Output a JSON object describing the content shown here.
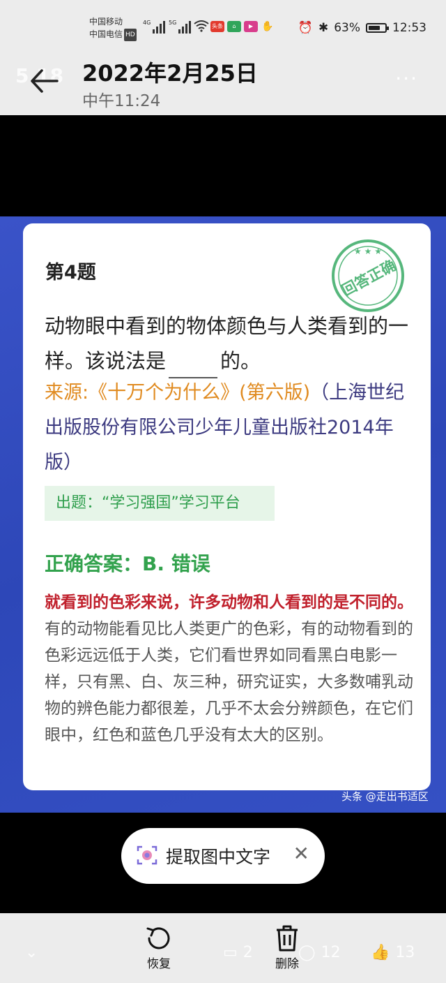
{
  "status": {
    "carrier1": "中国移动",
    "carrier2": "中国电信",
    "hd": "HD",
    "net1": "4G",
    "net2": "5G",
    "battery": "63%",
    "clock": "12:53"
  },
  "header": {
    "ghost_text": "5.18",
    "date": "2022年2月25日",
    "time": "中午11:24"
  },
  "card": {
    "question_number": "第4题",
    "stamp_text": "回答正确",
    "question_part1": "动物眼中看到的物体颜色与人类看到的一样。该说法是",
    "question_part2": "的。",
    "source_label": "来源:《十万个为什么》(第六版)",
    "source_rest": "（上海世纪出版股份有限公司少年儿童出版社2014年版）",
    "setter": "出题：“学习强国”学习平台",
    "answer": "正确答案：B. 错误",
    "explanation_red": "就看到的色彩来说，许多动物和人看到的是不同的。",
    "explanation_rest": "有的动物能看见比人类更广的色彩，有的动物看到的色彩远远低于人类，它们看世界如同看黑白电影一样，只有黑、白、灰三种，研究证实，大多数哺乳动物的辨色能力都很差，几乎不太会分辨颜色，在它们眼中，红色和蓝色几乎没有太大的区别。"
  },
  "watermark": "头条 @走出书适区",
  "ocr": {
    "label": "提取图中文字"
  },
  "bottom": {
    "restore": "恢复",
    "delete": "删除",
    "comments": "2",
    "messages": "12",
    "likes": "13"
  },
  "colors": {
    "photo_bg": "#2d47b8",
    "source_label": "#e08a1f",
    "answer": "#32a24d",
    "explanation_red": "#c0202c",
    "stamp": "#56b77c"
  }
}
